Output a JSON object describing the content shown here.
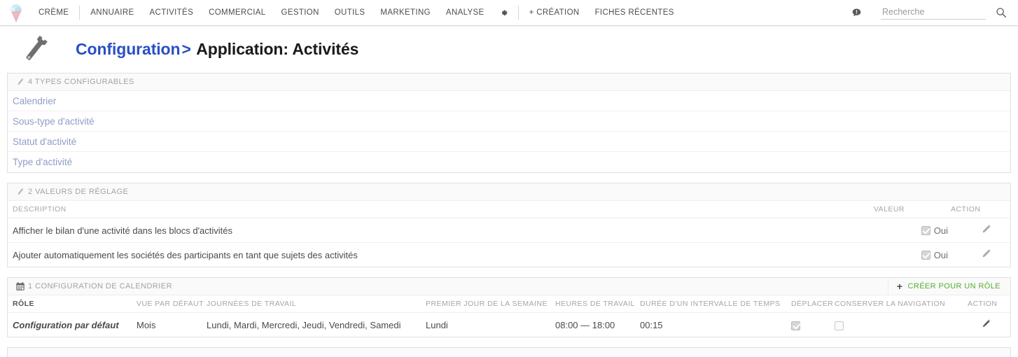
{
  "topnav": {
    "logo_icon": "ice-cream-cone-icon",
    "brand": "CRÈME",
    "items": [
      {
        "label": "ANNUAIRE"
      },
      {
        "label": "ACTIVITÉS"
      },
      {
        "label": "COMMERCIAL"
      },
      {
        "label": "GESTION"
      },
      {
        "label": "OUTILS"
      },
      {
        "label": "MARKETING"
      },
      {
        "label": "ANALYSE"
      }
    ],
    "gear_icon": "gear-icon",
    "create_label": "+ CRÉATION",
    "recent_label": "FICHES RÉCENTES",
    "alert_icon": "alert-bubble-icon",
    "search_placeholder": "Recherche",
    "search_value": "",
    "search_icon": "search-icon"
  },
  "page": {
    "head_icon": "wrench-icon",
    "breadcrumb": "Configuration",
    "breadcrumb_sep": ">",
    "title": "Application: Activités",
    "link_color": "#2a4fc4"
  },
  "panel_types": {
    "icon": "wrench-icon",
    "title": "4 TYPES CONFIGURABLES",
    "links": [
      {
        "label": "Calendrier"
      },
      {
        "label": "Sous-type d'activité"
      },
      {
        "label": "Statut d'activité"
      },
      {
        "label": "Type d'activité"
      }
    ]
  },
  "panel_settings": {
    "icon": "wrench-icon",
    "title": "2 VALEURS DE RÉGLAGE",
    "columns": [
      "DESCRIPTION",
      "VALEUR",
      "ACTION"
    ],
    "rows": [
      {
        "description": "Afficher le bilan d'une activité dans les blocs d'activités",
        "value_checked": true,
        "value_label": "Oui",
        "action_icon": "pencil-icon"
      },
      {
        "description": "Ajouter automatiquement les sociétés des participants en tant que sujets des activités",
        "value_checked": true,
        "value_label": "Oui",
        "action_icon": "pencil-icon"
      }
    ]
  },
  "panel_calendar": {
    "icon": "calendar-icon",
    "title": "1 CONFIGURATION DE CALENDRIER",
    "action_label": "CRÉER POUR UN RÔLE",
    "action_plus": "+",
    "action_color": "#52b031",
    "columns": [
      "RÔLE",
      "VUE PAR DÉFAUT",
      "JOURNÉES DE TRAVAIL",
      "PREMIER JOUR DE LA SEMAINE",
      "HEURES DE TRAVAIL",
      "DURÉE D'UN INTERVALLE DE TEMPS",
      "DÉPLACER",
      "CONSERVER LA NAVIGATION",
      "ACTION"
    ],
    "rows": [
      {
        "role": "Configuration par défaut",
        "default_view": "Mois",
        "work_days": "Lundi, Mardi, Mercredi, Jeudi, Vendredi, Samedi",
        "first_day": "Lundi",
        "work_hours": "08:00 — 18:00",
        "slot_duration": "00:15",
        "move_checked": true,
        "keep_nav_checked": false,
        "action_icon": "pencil-icon"
      }
    ]
  }
}
